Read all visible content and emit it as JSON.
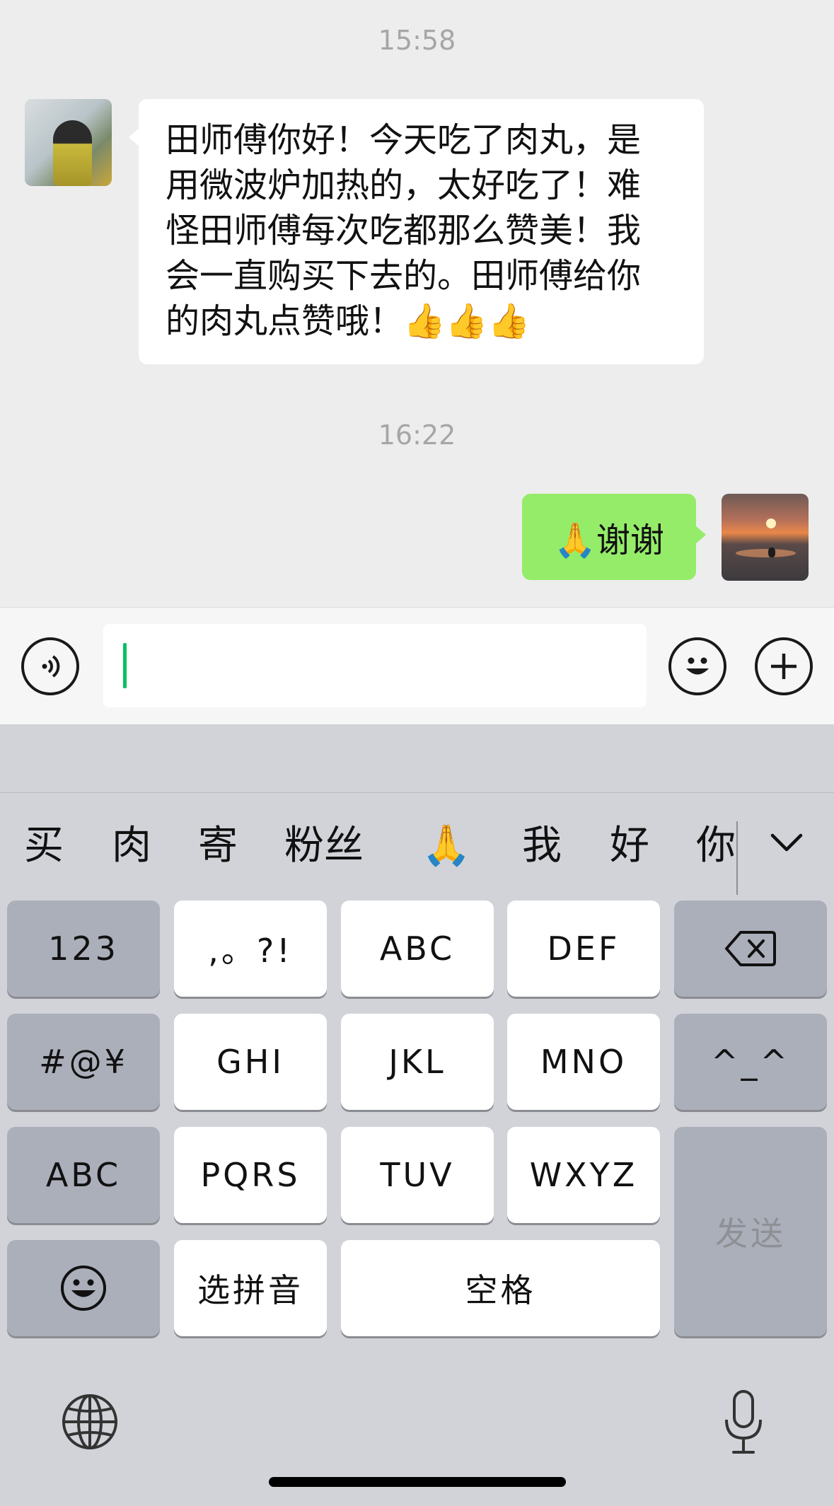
{
  "chat": {
    "timestamp_1": "15:58",
    "incoming_message": "田师傅你好！今天吃了肉丸，是\n用微波炉加热的，太好吃了！难\n怪田师傅每次吃都那么赞美！我\n会一直购买下去的。田师傅给你\n的肉丸点赞哦！👍👍👍",
    "timestamp_2": "16:22",
    "outgoing_message": "🙏谢谢"
  },
  "input_bar": {
    "text_value": "",
    "icons": [
      "voice-icon",
      "emoji-icon",
      "plus-icon"
    ]
  },
  "keyboard": {
    "candidates": [
      "买",
      "肉",
      "寄",
      "粉丝",
      "🙏",
      "我",
      "好",
      "你"
    ],
    "keys": {
      "k123": "123",
      "punct": ",。?!",
      "abc": "ABC",
      "def": "DEF",
      "symbols": "#@¥",
      "ghi": "GHI",
      "jkl": "JKL",
      "mno": "MNO",
      "kaomoji": "^_^",
      "abc_mode": "ABC",
      "pqrs": "PQRS",
      "tuv": "TUV",
      "wxyz": "WXYZ",
      "send": "发送",
      "select_pinyin": "选拼音",
      "space": "空格"
    },
    "icons": [
      "backspace-icon",
      "emoji-icon",
      "globe-icon",
      "microphone-icon",
      "chevron-down-icon"
    ]
  },
  "colors": {
    "chat_background": "#ededed",
    "outgoing_bubble": "#95ec69",
    "caret": "#07c160",
    "keyboard_background": "#d1d3d9",
    "function_key": "#abafba"
  }
}
